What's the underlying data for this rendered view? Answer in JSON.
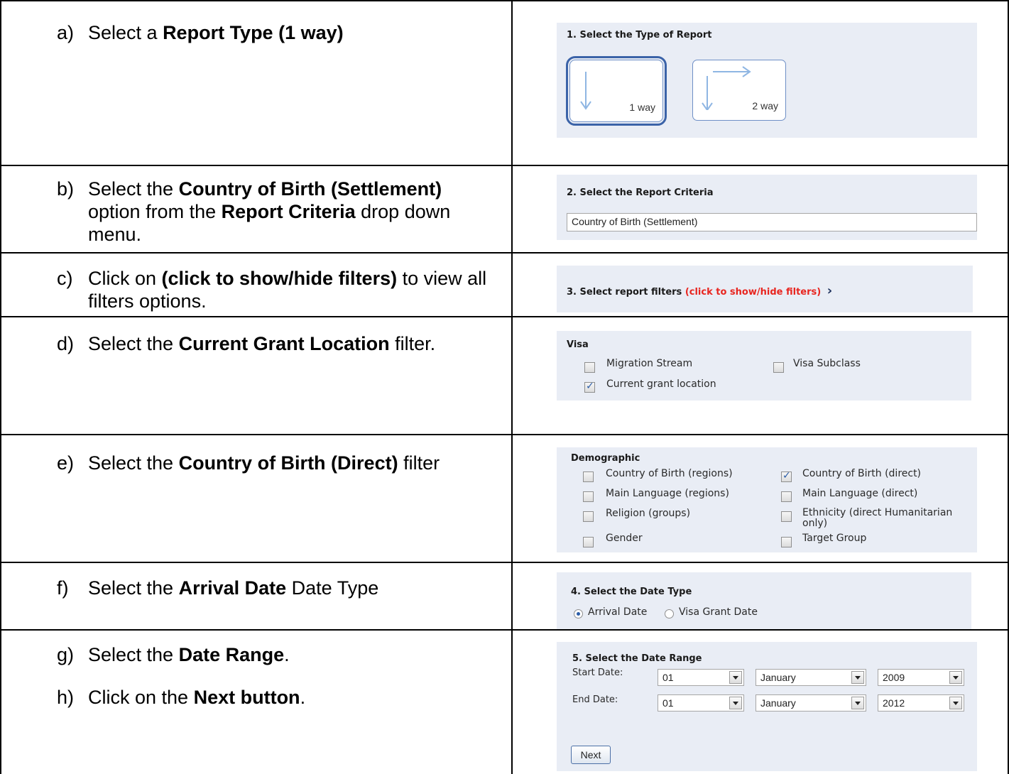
{
  "steps": {
    "a": {
      "label": "a)",
      "pre": "Select a ",
      "bold": "Report Type (1 way)"
    },
    "b": {
      "label": "b)",
      "pre": "Select the ",
      "bold1": "Country of Birth (Settlement)",
      "mid": " option from the ",
      "bold2": "Report Criteria",
      "post": " drop down menu."
    },
    "c": {
      "label": "c)",
      "pre": "Click on ",
      "bold": "(click to show/hide filters)",
      "post": " to view all filters options."
    },
    "d": {
      "label": "d)",
      "pre": "Select the ",
      "bold": "Current Grant Location",
      "post": " filter."
    },
    "e": {
      "label": "e)",
      "pre": "Select the ",
      "bold": "Country of Birth (Direct)",
      "post": " filter"
    },
    "f": {
      "label": "f)",
      "pre": "Select the ",
      "bold": "Arrival Date",
      "post": " Date Type"
    },
    "g": {
      "label": "g)",
      "pre": "Select the ",
      "bold": "Date Range",
      "post": "."
    },
    "h": {
      "label": "h)",
      "pre": "Click on the ",
      "bold": "Next button",
      "post": "."
    }
  },
  "report_type": {
    "title": "1. Select the Type of Report",
    "options": [
      "1 way",
      "2 way"
    ],
    "selected": "1 way"
  },
  "report_criteria": {
    "title": "2. Select the Report Criteria",
    "value": "Country of Birth (Settlement)"
  },
  "report_filters": {
    "title": "3. Select report filters ",
    "toggle": "(click to show/hide filters)",
    "chevron": "›",
    "toggle_color": "#e8251f"
  },
  "visa": {
    "heading": "Visa",
    "items": [
      {
        "label": "Migration Stream",
        "checked": false
      },
      {
        "label": "Visa Subclass",
        "checked": false
      },
      {
        "label": "Current grant location",
        "checked": true
      }
    ]
  },
  "demographic": {
    "heading": "Demographic",
    "items": [
      {
        "label": "Country of Birth (regions)",
        "checked": false
      },
      {
        "label": "Country of Birth (direct)",
        "checked": true
      },
      {
        "label": "Main Language (regions)",
        "checked": false
      },
      {
        "label": "Main Language (direct)",
        "checked": false
      },
      {
        "label": "Religion (groups)",
        "checked": false
      },
      {
        "label": "Ethnicity (direct Humanitarian only)",
        "checked": false
      },
      {
        "label": "Gender",
        "checked": false
      },
      {
        "label": "Target Group",
        "checked": false
      }
    ]
  },
  "date_type": {
    "title": "4. Select the Date Type",
    "options": [
      "Arrival Date",
      "Visa Grant Date"
    ],
    "selected": "Arrival Date"
  },
  "date_range": {
    "title": "5. Select the Date Range",
    "start_label": "Start Date:",
    "end_label": "End Date:",
    "start": {
      "day": "01",
      "month": "January",
      "year": "2009"
    },
    "end": {
      "day": "01",
      "month": "January",
      "year": "2012"
    },
    "next_label": "Next"
  }
}
